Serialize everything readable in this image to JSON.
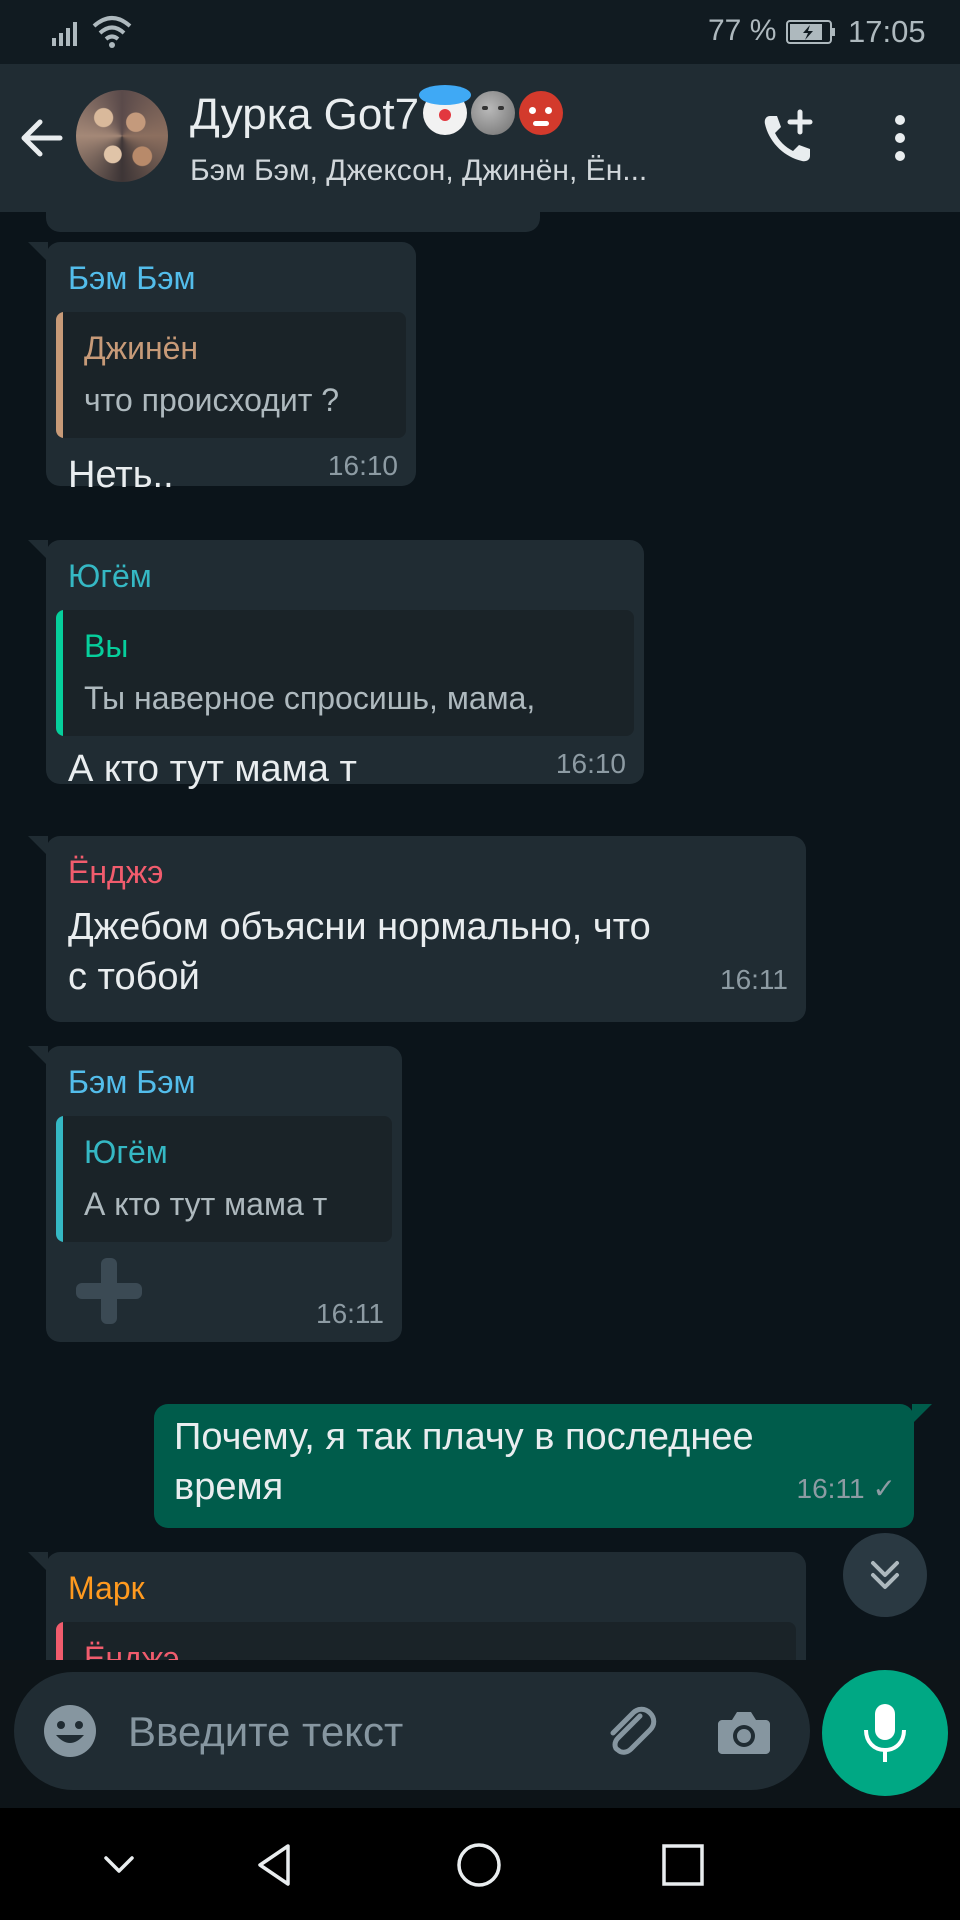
{
  "status_bar": {
    "battery_percent": "77 %",
    "time": "17:05"
  },
  "header": {
    "title": "Дурка Got7",
    "title_emojis": [
      "clown-face-emoji",
      "new-moon-face-emoji",
      "ogre-emoji"
    ],
    "subtitle": "Бэм Бэм, Джексон, Джинён, Ён..."
  },
  "messages": [
    {
      "sender": "Бэм Бэм",
      "sender_color": "#53bdeb",
      "quote": {
        "name": "Джинён",
        "name_color": "#c79a78",
        "text": "что происходит ?"
      },
      "text": "Неть..",
      "time": "16:10"
    },
    {
      "sender": "Югём",
      "sender_color": "#35b8c4",
      "quote": {
        "name": "Вы",
        "name_color": "#06cf9c",
        "text": "Ты наверное спросишь, мама,"
      },
      "text": "А кто тут мама т",
      "time": "16:10"
    },
    {
      "sender": "Ёнджэ",
      "sender_color": "#f15c6d",
      "text": "Джебом объясни нормально, что с тобой",
      "time": "16:11"
    },
    {
      "sender": "Бэм Бэм",
      "sender_color": "#53bdeb",
      "quote": {
        "name": "Югём",
        "name_color": "#35b8c4",
        "text": "А кто тут мама т"
      },
      "sticker": "plus-sticker",
      "time": "16:11"
    },
    {
      "outgoing": true,
      "text": "Почему, я так плачу в последнее время",
      "time": "16:11",
      "status": "✓"
    },
    {
      "sender": "Марк",
      "sender_color": "#ff9a1f",
      "quote": {
        "name": "Ёнджэ",
        "name_color": "#f15c6d"
      }
    }
  ],
  "input": {
    "placeholder": "Введите текст"
  },
  "colors": {
    "background": "#0b141a",
    "incoming": "#202c33",
    "outgoing": "#005c4b",
    "accent": "#00a884"
  }
}
